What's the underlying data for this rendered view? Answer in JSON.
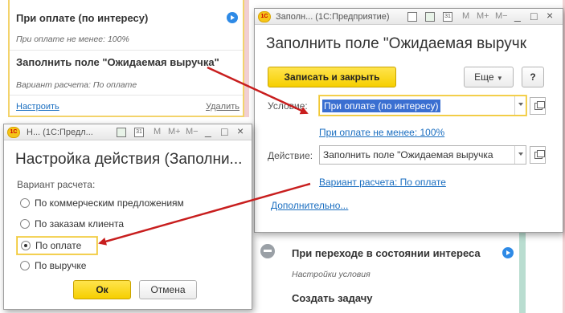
{
  "bg_top": {
    "item1_title": "При оплате (по интересу)",
    "item1_sub": "При оплате не менее: 100%",
    "item2_title": "Заполнить  поле  \"Ожидаемая  выручка\"",
    "item2_sub": "Вариант расчета: По оплате",
    "setup_link": "Настроить",
    "delete_link": "Удалить"
  },
  "bg_bottom": {
    "state_title": "При переходе в состоянии интереса",
    "conditions_sub": "Настройки условия",
    "create_task": "Создать задачу"
  },
  "win_fill": {
    "title": "Заполн...  (1С:Предприятие)",
    "heading": "Заполнить  поле  \"Ожидаемая  выручк",
    "save_close": "Записать и закрыть",
    "more": "Еще",
    "help": "?",
    "condition_label": "Условие:",
    "condition_value": "При оплате (по интересу)",
    "condition_link": "При оплате не менее: 100%",
    "action_label": "Действие:",
    "action_value": "Заполнить  поле  \"Ожидаемая  выручка",
    "calc_link": "Вариант расчета: По оплате",
    "more_link": "Дополнительно..."
  },
  "win_setup": {
    "title": "Н...  (1С:Предл...",
    "heading": "Настройка действия (Заполни...",
    "group_label": "Вариант расчета:",
    "options": [
      "По коммерческим предложениям",
      "По заказам клиента",
      "По оплате",
      "По выручке"
    ],
    "selected_index": 2,
    "ok": "Ок",
    "cancel": "Отмена"
  },
  "toolbar_glyphs": {
    "m": "M",
    "m_plus": "M+",
    "m_minus": "M−",
    "minimize": "_",
    "maximize": "□",
    "close": "×",
    "calendar": "31"
  },
  "colors": {
    "accent_yellow": "#f6cf00",
    "link_blue": "#1a6ec0",
    "arrow_red": "#c81e1e"
  }
}
